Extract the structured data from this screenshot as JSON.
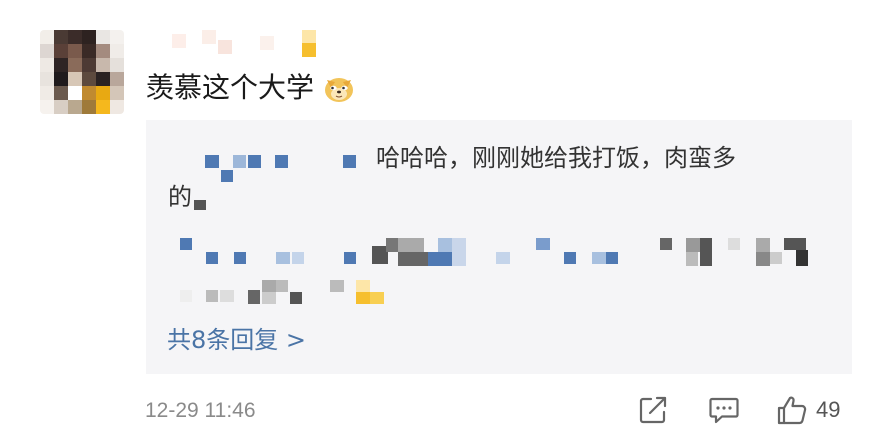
{
  "comment": {
    "text": "羡慕这个大学",
    "emoji": "doge-emoji"
  },
  "reply": {
    "line1": "哈哈哈，刚刚她给我打饭，肉蛮多",
    "line2": "的"
  },
  "more_replies": "共8条回复 >",
  "footer": {
    "timestamp": "12-29 11:46",
    "like_count": "49"
  },
  "colors": {
    "link": "#4a74a6",
    "reply_bg": "#f5f5f7",
    "mosaic_blue": "#4f79b3"
  }
}
